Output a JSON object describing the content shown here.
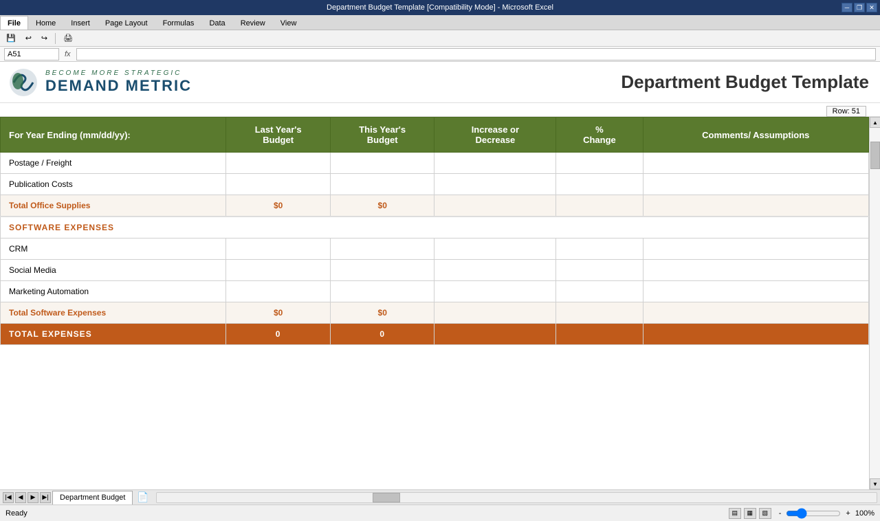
{
  "window": {
    "title": "Department Budget Template [Compatibility Mode] - Microsoft Excel",
    "title_controls": [
      "minimize",
      "maximize",
      "close"
    ]
  },
  "ribbon": {
    "tabs": [
      "File",
      "Home",
      "Insert",
      "Page Layout",
      "Formulas",
      "Data",
      "Review",
      "View"
    ],
    "active_tab": "File"
  },
  "header": {
    "logo_tagline": "Become More Strategic",
    "logo_name": "Demand Metric",
    "doc_title": "Department Budget Template",
    "row_indicator": "Row: 51"
  },
  "formula_bar": {
    "name_box": "A51",
    "fx_label": "fx",
    "formula": ""
  },
  "table": {
    "columns": [
      {
        "label": "For Year Ending (mm/dd/yy):"
      },
      {
        "label": "Last Year's Budget"
      },
      {
        "label": "This Year's Budget"
      },
      {
        "label": "Increase or Decrease"
      },
      {
        "label": "% Change"
      },
      {
        "label": "Comments/ Assumptions"
      }
    ],
    "sections": [
      {
        "rows": [
          {
            "label": "Postage / Freight",
            "last": "",
            "this": "",
            "increase": "",
            "pct": "",
            "comments": ""
          },
          {
            "label": "Publication Costs",
            "last": "",
            "this": "",
            "increase": "",
            "pct": "",
            "comments": ""
          },
          {
            "label": "Total Office Supplies",
            "last": "$0",
            "this": "$0",
            "increase": "",
            "pct": "",
            "comments": "",
            "type": "total"
          }
        ]
      },
      {
        "header": "SOFTWARE EXPENSES",
        "rows": [
          {
            "label": "CRM",
            "last": "",
            "this": "",
            "increase": "",
            "pct": "",
            "comments": ""
          },
          {
            "label": "Social Media",
            "last": "",
            "this": "",
            "increase": "",
            "pct": "",
            "comments": ""
          },
          {
            "label": "Marketing Automation",
            "last": "",
            "this": "",
            "increase": "",
            "pct": "",
            "comments": ""
          },
          {
            "label": "Total Software Expenses",
            "last": "$0",
            "this": "$0",
            "increase": "",
            "pct": "",
            "comments": "",
            "type": "total"
          }
        ]
      }
    ],
    "grand_total": {
      "label": "TOTAL EXPENSES",
      "last": "0",
      "this": "0",
      "increase": "",
      "pct": "",
      "comments": ""
    }
  },
  "sheet_tabs": [
    {
      "label": "Department Budget",
      "active": true
    }
  ],
  "status_bar": {
    "ready": "Ready",
    "zoom": "100%",
    "zoom_out": "-",
    "zoom_in": "+"
  }
}
